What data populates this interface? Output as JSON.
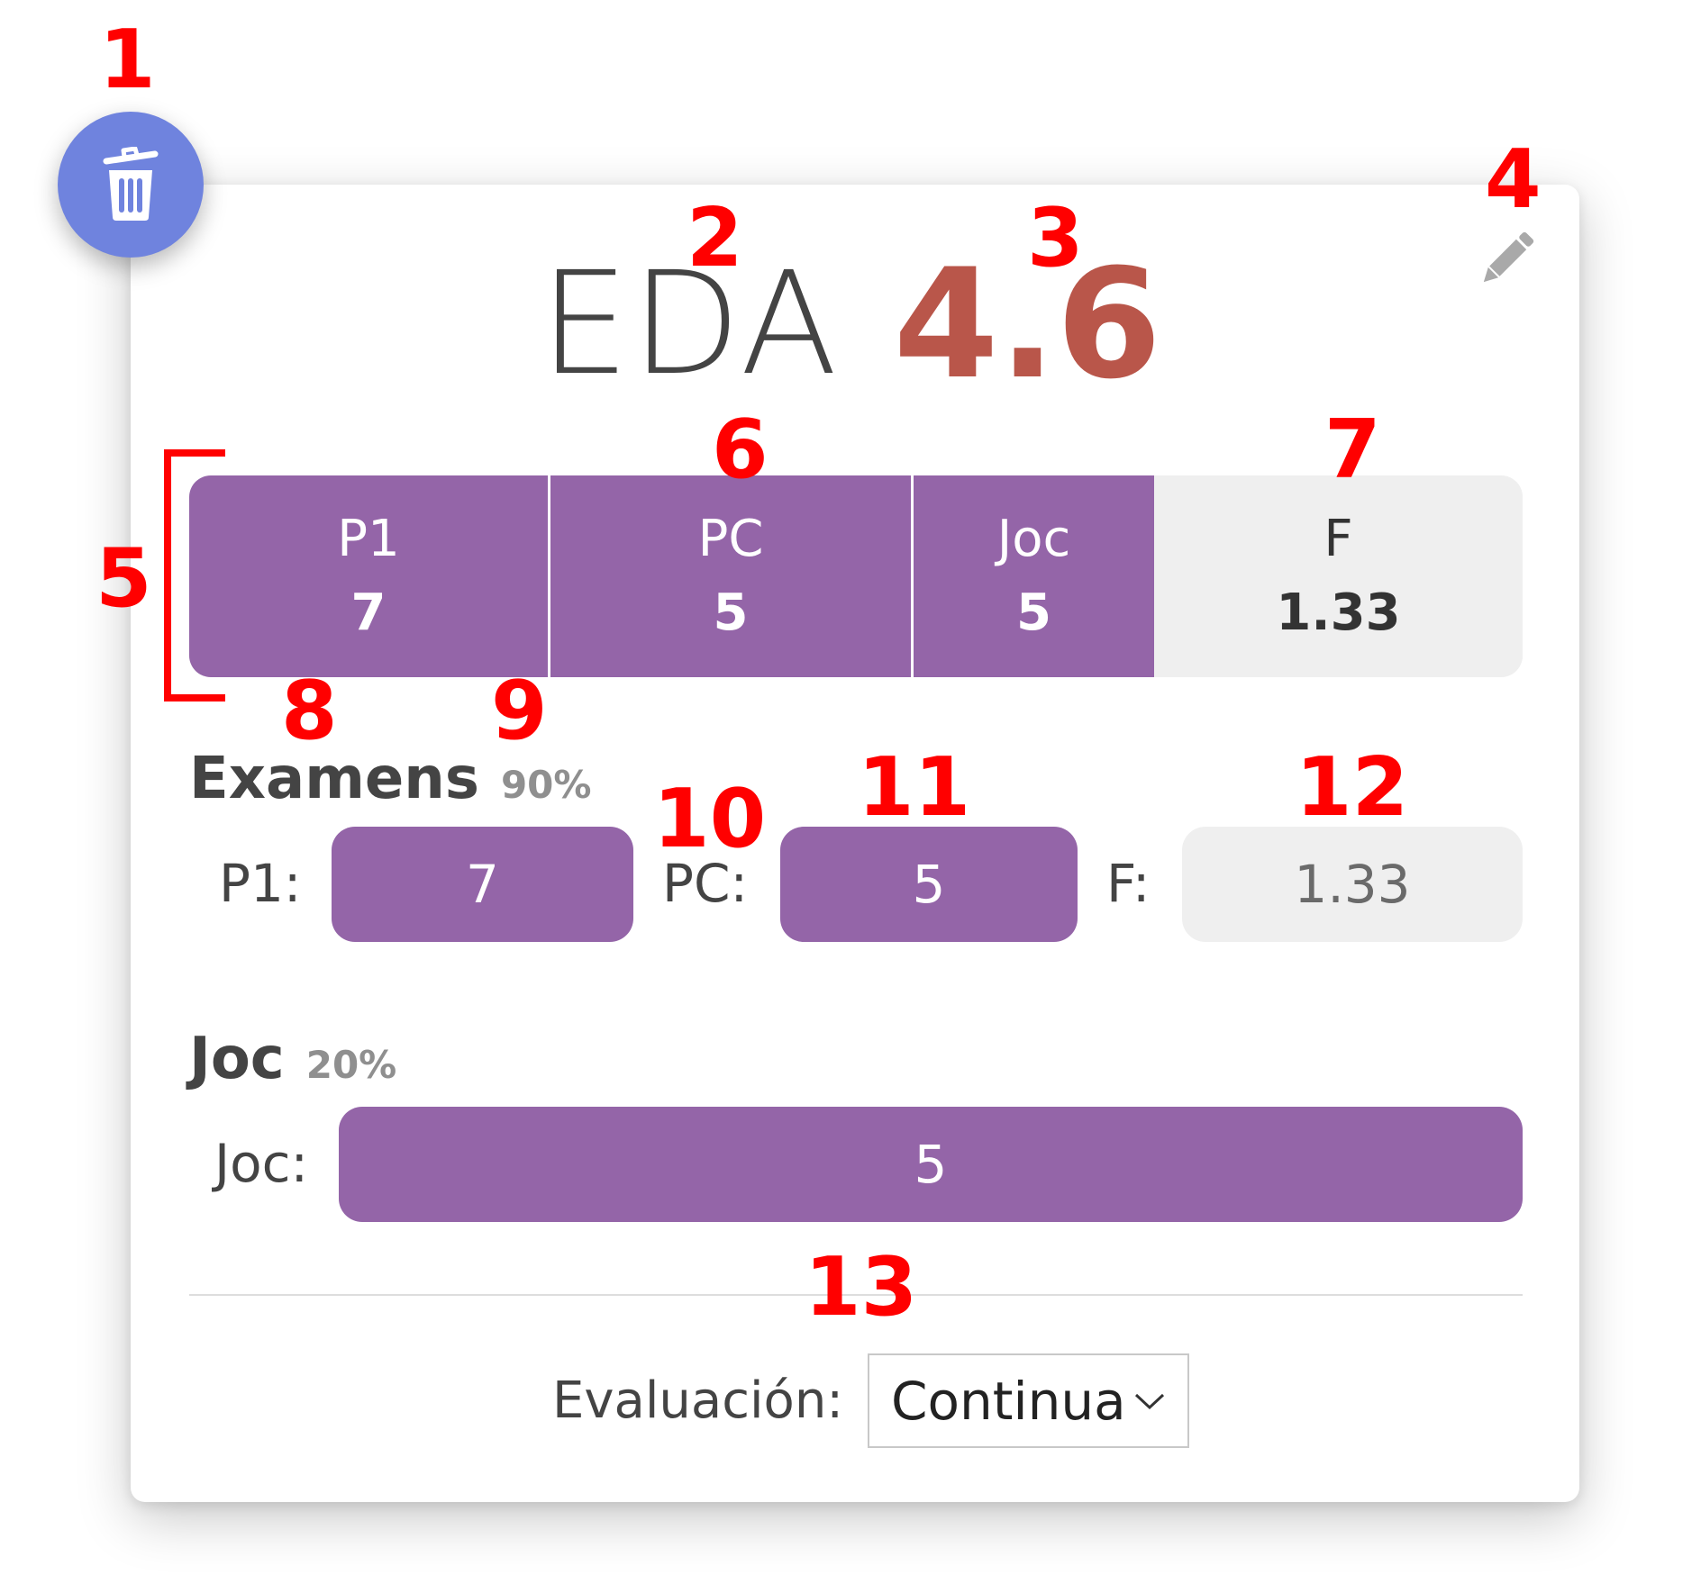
{
  "header": {
    "subject": "EDA",
    "grade": "4.6"
  },
  "summary": {
    "segments": [
      {
        "label": "P1",
        "value": "7"
      },
      {
        "label": "PC",
        "value": "5"
      },
      {
        "label": "Joc",
        "value": "5"
      },
      {
        "label": "F",
        "value": "1.33"
      }
    ]
  },
  "examens": {
    "title": "Examens",
    "percent": "90%",
    "fields": [
      {
        "label": "P1:",
        "value": "7"
      },
      {
        "label": "PC:",
        "value": "5"
      },
      {
        "label": "F:",
        "value": "1.33"
      }
    ]
  },
  "joc": {
    "title": "Joc",
    "percent": "20%",
    "field": {
      "label": "Joc:",
      "value": "5"
    }
  },
  "evaluation": {
    "label": "Evaluación:",
    "selected": "Continua"
  },
  "annotations": [
    "1",
    "2",
    "3",
    "4",
    "5",
    "6",
    "7",
    "8",
    "9",
    "10",
    "11",
    "12",
    "13"
  ],
  "colors": {
    "accent_purple": "#9465a8",
    "fab_blue": "#6f83de",
    "grade_red": "#b9564a",
    "annotation_red": "#ff0000",
    "neutral_grey": "#efefef"
  },
  "icons": {
    "fab": "trash-icon",
    "edit": "pencil-icon",
    "select": "chevron-down-icon"
  }
}
